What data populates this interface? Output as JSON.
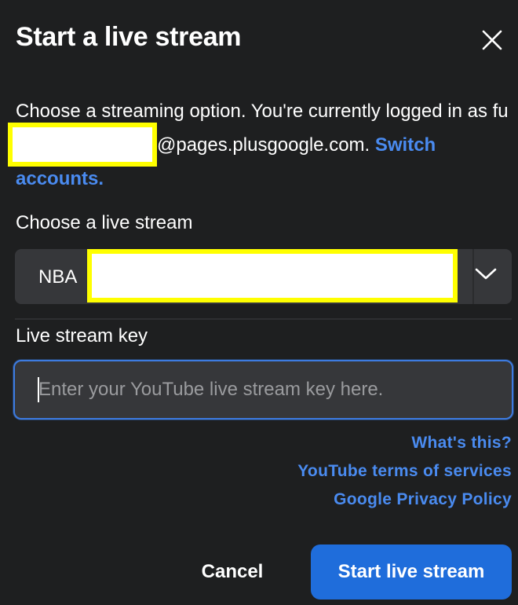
{
  "dialog": {
    "title": "Start a live stream",
    "close_icon": "close-icon"
  },
  "intro": {
    "text_before": "Choose a streaming option. You're currently logged in as fu",
    "text_after": "@pages.plusgoogle.com. ",
    "switch_link": "Switch accounts."
  },
  "stream_select": {
    "label": "Choose a live stream",
    "selected_value": "NBA",
    "chevron_icon": "chevron-down-icon"
  },
  "stream_key": {
    "label": "Live stream key",
    "placeholder": "Enter your YouTube live stream key here.",
    "value": ""
  },
  "help_links": [
    "What's this?",
    "YouTube terms of services",
    "Google Privacy Policy"
  ],
  "actions": {
    "cancel_label": "Cancel",
    "start_label": "Start live stream"
  },
  "colors": {
    "background": "#1e1f20",
    "field": "#36373a",
    "link": "#4a8bf0",
    "primary_button": "#1f6ddb",
    "redaction_border": "#ffff00"
  }
}
